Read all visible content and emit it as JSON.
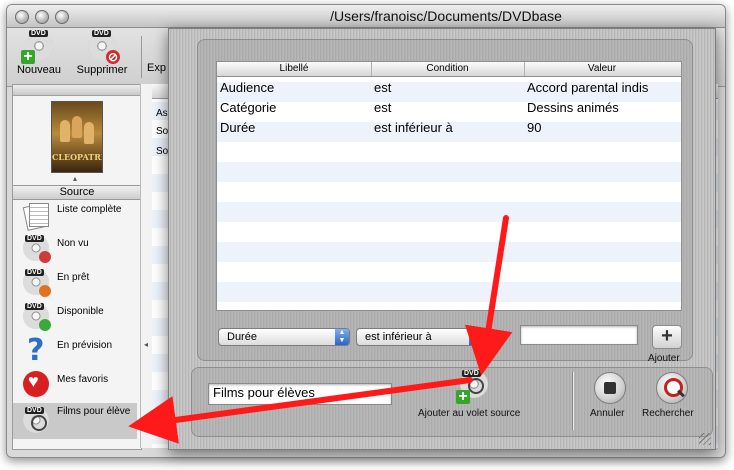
{
  "window": {
    "title": "/Users/franoisc/Documents/DVDbase"
  },
  "toolbar": {
    "items": [
      {
        "label": "Nouveau",
        "icon": "dvd-add-icon"
      },
      {
        "label": "Supprimer",
        "icon": "dvd-delete-icon"
      },
      {
        "label": "Exp",
        "icon": "export-icon"
      }
    ]
  },
  "sidebar": {
    "poster_text": "CLEOPATRE",
    "source_header": "Source",
    "items": [
      {
        "label": "Liste complète",
        "icon": "documents-icon"
      },
      {
        "label": "Non vu",
        "icon": "dvd-unseen-icon"
      },
      {
        "label": "En prêt",
        "icon": "dvd-lent-icon"
      },
      {
        "label": "Disponible",
        "icon": "dvd-available-icon"
      },
      {
        "label": "En prévision",
        "icon": "question-icon"
      },
      {
        "label": "Mes favoris",
        "icon": "heart-icon"
      },
      {
        "label": "Films pour élève",
        "icon": "dvd-search-icon"
      }
    ]
  },
  "background_list": {
    "cells": [
      "As",
      "So",
      "So"
    ]
  },
  "criteria": {
    "columns": [
      "Libellé",
      "Condition",
      "Valeur"
    ],
    "rows": [
      {
        "libelle": "Audience",
        "condition": "est",
        "valeur": "Accord parental indis"
      },
      {
        "libelle": "Catégorie",
        "condition": "est",
        "valeur": "Dessins animés"
      },
      {
        "libelle": "Durée",
        "condition": "est inférieur à",
        "valeur": "90"
      }
    ],
    "field_popup": "Durée",
    "condition_popup": "est inférieur à",
    "value_input": "",
    "add_label": "Ajouter"
  },
  "bottom": {
    "name_input": "Films pour élèves",
    "add_source_label": "Ajouter au volet source",
    "cancel_label": "Annuler",
    "search_label": "Rechercher"
  },
  "colors": {
    "arrow": "#ff1a1a",
    "add_green": "#35a62b",
    "delete_red": "#d42a2a",
    "popup_blue": "#2a64c8"
  }
}
